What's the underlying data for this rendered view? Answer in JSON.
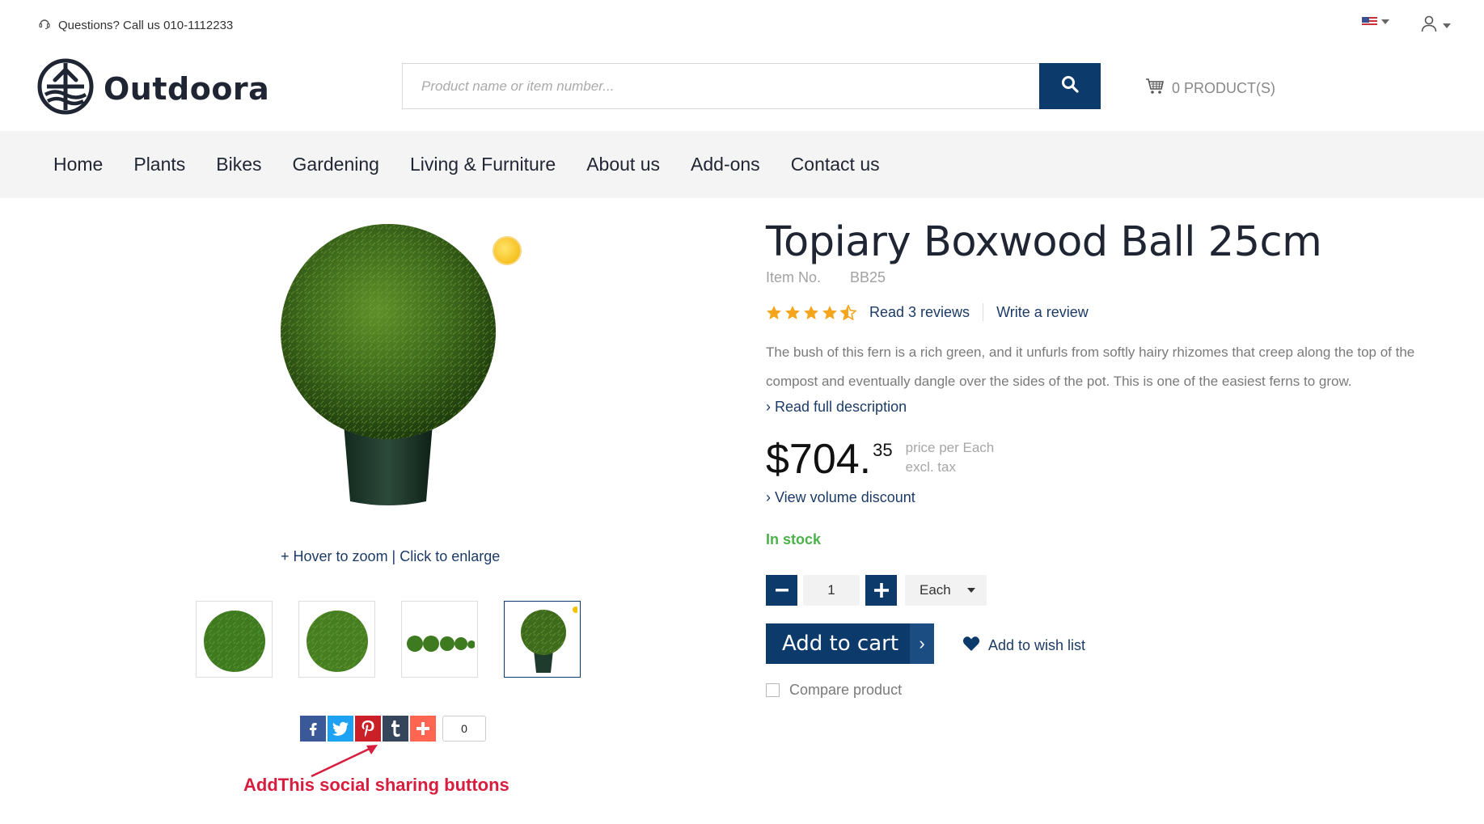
{
  "topbar": {
    "phone_text": "Questions? Call us 010-1112233",
    "language_icon": "us-flag-icon",
    "account_icon": "user-icon"
  },
  "header": {
    "brand_name": "Outdoora",
    "search_placeholder": "Product name or item number...",
    "search_icon": "search-icon",
    "cart_text": "0 PRODUCT(S)"
  },
  "nav": {
    "items": [
      {
        "label": "Home"
      },
      {
        "label": "Plants"
      },
      {
        "label": "Bikes"
      },
      {
        "label": "Gardening"
      },
      {
        "label": "Living & Furniture"
      },
      {
        "label": "About us"
      },
      {
        "label": "Add-ons"
      },
      {
        "label": "Contact us"
      }
    ]
  },
  "gallery": {
    "zoom_hint": "+ Hover to zoom | Click to enlarge",
    "thumbnails": [
      {
        "name": "boxwood-ball-thumb"
      },
      {
        "name": "boxwood-ball-thumb-2"
      },
      {
        "name": "boxwood-ball-row-thumb"
      },
      {
        "name": "boxwood-ball-pot-thumb",
        "active": true
      }
    ]
  },
  "share": {
    "buttons": [
      {
        "icon": "facebook-icon",
        "glyph": "f",
        "color": "#3b5998"
      },
      {
        "icon": "twitter-icon",
        "glyph": "t",
        "color": "#1da1f2"
      },
      {
        "icon": "pinterest-icon",
        "glyph": "p",
        "color": "#cb2027"
      },
      {
        "icon": "tumblr-icon",
        "glyph": "t",
        "color": "#35465c"
      },
      {
        "icon": "addthis-plus-icon",
        "glyph": "+",
        "color": "#ff6550"
      }
    ],
    "count": "0",
    "annotation": "AddThis social sharing buttons"
  },
  "product": {
    "title": "Topiary Boxwood Ball 25cm",
    "item_no_label": "Item No.",
    "item_no_value": "BB25",
    "rating": 4.5,
    "read_reviews": "Read 3 reviews",
    "write_review": "Write a review",
    "description": "The bush of this fern is a rich green, and it unfurls from softly hairy rhizomes that creep along the top of the compost and eventually dangle over the sides of the pot. This is one of the easiest ferns to grow.",
    "read_full": "› Read full description",
    "price_main": "$704.",
    "price_cents": "35",
    "price_per": "price per Each",
    "price_tax": "excl. tax",
    "volume_discount": "› View volume discount",
    "stock_status": "In stock",
    "quantity": "1",
    "unit": "Each",
    "add_to_cart": "Add to cart",
    "add_to_cart_arrow": "›",
    "add_to_wishlist": "Add to wish list",
    "compare": "Compare product"
  },
  "colors": {
    "brand_navy": "#0c3a6b",
    "in_stock_green": "#4bb24a",
    "star_gold": "#f4a51c",
    "annotation_red": "#d81e3e"
  }
}
